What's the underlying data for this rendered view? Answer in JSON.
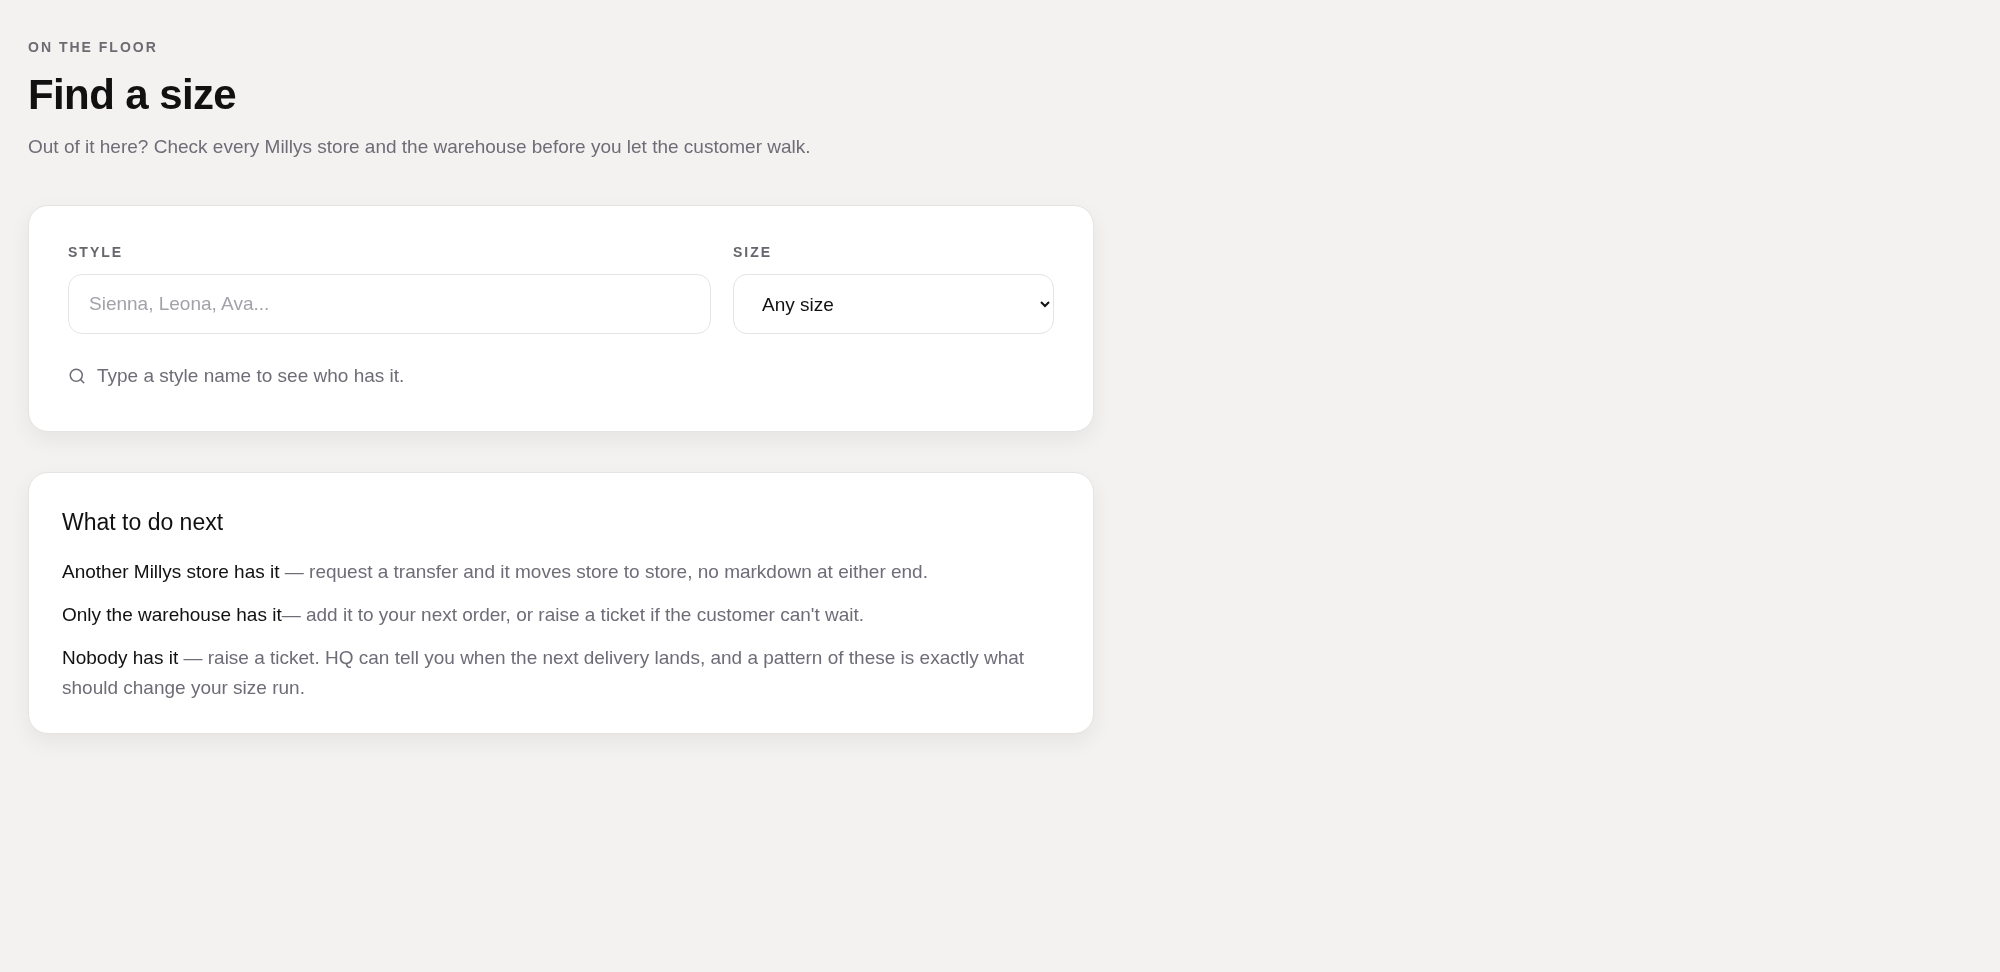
{
  "eyebrow": "ON THE FLOOR",
  "title": "Find a size",
  "subtitle": "Out of it here? Check every Millys store and the warehouse before you let the customer walk.",
  "search_card": {
    "fields": [
      {
        "kind": "text",
        "label": "STYLE",
        "placeholder": "Sienna, Leona, Ava..."
      },
      {
        "kind": "select",
        "label": "SIZE",
        "value": "Any size"
      }
    ],
    "hint": "Type a style name to see who has it."
  },
  "next_steps": {
    "title": "What to do next",
    "items": [
      {
        "lead": "Another Millys store has it ",
        "text": "— request a transfer and it moves store to store, no markdown at either end."
      },
      {
        "lead": "Only the warehouse has it",
        "text": "— add it to your next order, or raise a ticket if the customer can't wait."
      },
      {
        "lead": "Nobody has it ",
        "text": "— raise a ticket. HQ can tell you when the next delivery lands, and a pattern of these is exactly what should change your size run."
      }
    ]
  }
}
